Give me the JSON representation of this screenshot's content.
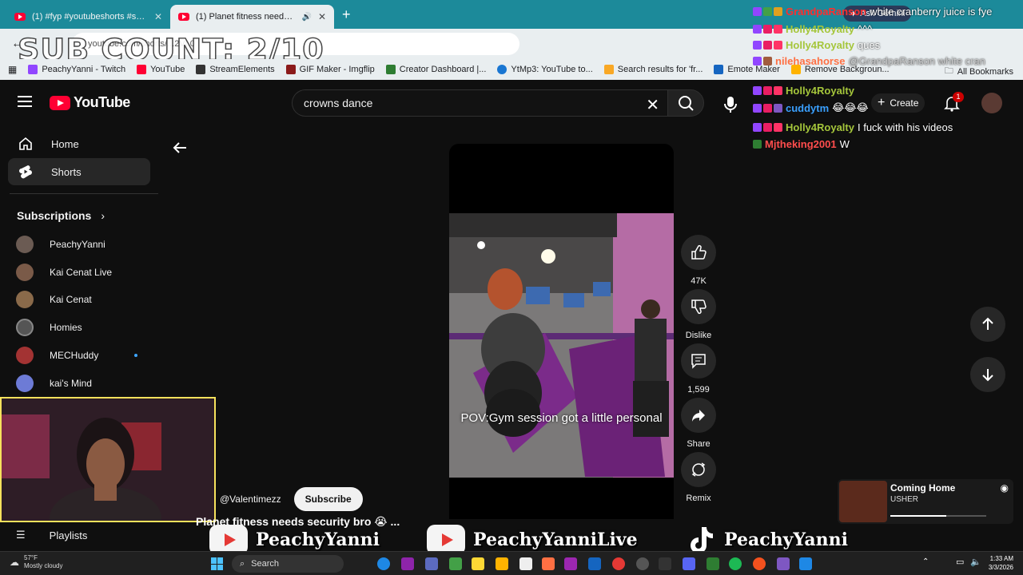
{
  "browser": {
    "tabs": [
      {
        "label": "(1) #fyp #youtubeshorts #short",
        "active": false
      },
      {
        "label": "(1) Planet fitness needs secu",
        "active": true
      }
    ],
    "url_partial": "youtube.com/shorts/...2VL0",
    "bookmarks": [
      {
        "label": "PeachyYanni - Twitch",
        "color": "#9146ff"
      },
      {
        "label": "YouTube",
        "color": "#ff0033"
      },
      {
        "label": "StreamElements",
        "color": "#333333"
      },
      {
        "label": "GIF Maker - Imgflip",
        "color": "#8b1a1a"
      },
      {
        "label": "Creator Dashboard |...",
        "color": "#2e7d32"
      },
      {
        "label": "YtMp3: YouTube to...",
        "color": "#1976d2"
      },
      {
        "label": "Search results for 'fr...",
        "color": "#f9a825"
      },
      {
        "label": "Emote Maker",
        "color": "#1565c0"
      },
      {
        "label": "Remove Backgroun...",
        "color": "#ffb300"
      }
    ],
    "all_bookmarks": "All Bookmarks"
  },
  "overlay": {
    "sub_count": "SUB COUNT: 2/10"
  },
  "header": {
    "logo_text": "YouTube",
    "search_value": "crowns dance",
    "create_label": "Create",
    "notif_count": "1",
    "gemini_label": "Ask Gemini"
  },
  "sidebar": {
    "home": "Home",
    "shorts": "Shorts",
    "subscriptions_heading": "Subscriptions",
    "subscriptions": [
      {
        "name": "PeachyYanni",
        "color": "#6b5b53"
      },
      {
        "name": "Kai Cenat Live",
        "color": "#7a5a48"
      },
      {
        "name": "Kai Cenat",
        "color": "#8a6a4a"
      },
      {
        "name": "Homies",
        "color": "#555555"
      },
      {
        "name": "MECHuddy",
        "color": "#a33333"
      },
      {
        "name": "kai's Mind",
        "color": "#6d7bd6"
      }
    ],
    "playlists": "Playlists"
  },
  "short": {
    "caption": "POV:Gym session got a little personal",
    "channel": "@Valentimezz",
    "subscribe": "Subscribe",
    "title_marquee": "Planet fitness needs security bro 😭 ...",
    "actions": {
      "like_count": "47K",
      "dislike_label": "Dislike",
      "comments_count": "1,599",
      "share_label": "Share",
      "remix_label": "Remix"
    }
  },
  "chat": [
    {
      "name": "GrandpaRanson",
      "color": "#ff2d2d",
      "message": "white cranberry juice is fye"
    },
    {
      "name": "Holly4Royalty",
      "color": "#a5c63b",
      "message": "^^^"
    },
    {
      "name": "Holly4Royalty",
      "color": "#a5c63b",
      "message": "ques"
    },
    {
      "name": "nilehasahorse",
      "color": "#ff7043",
      "message": "@GrandpaRanson white cran"
    },
    {
      "name": "Holly4Royalty",
      "color": "#a5c63b",
      "message": ""
    },
    {
      "name": "cuddytm",
      "color": "#3aa0ff",
      "message": "😂😂😂"
    },
    {
      "name": "Holly4Royalty",
      "color": "#a5c63b",
      "message": "I fuck with his videos"
    },
    {
      "name": "Mjtheking2001",
      "color": "#ff4d4d",
      "message": "W"
    }
  ],
  "now_playing": {
    "title": "Coming Home",
    "artist": "USHER",
    "progress": 0.58
  },
  "socials": [
    {
      "handle": "PeachyYanni",
      "platform": "youtube"
    },
    {
      "handle": "PeachyYanniLive",
      "platform": "youtube"
    },
    {
      "handle": "PeachyYanni",
      "platform": "tiktok"
    }
  ],
  "taskbar": {
    "temp": "57°F",
    "weather": "Mostly cloudy",
    "search": "Search",
    "time": "1:33 AM",
    "date": "3/3/2026"
  }
}
